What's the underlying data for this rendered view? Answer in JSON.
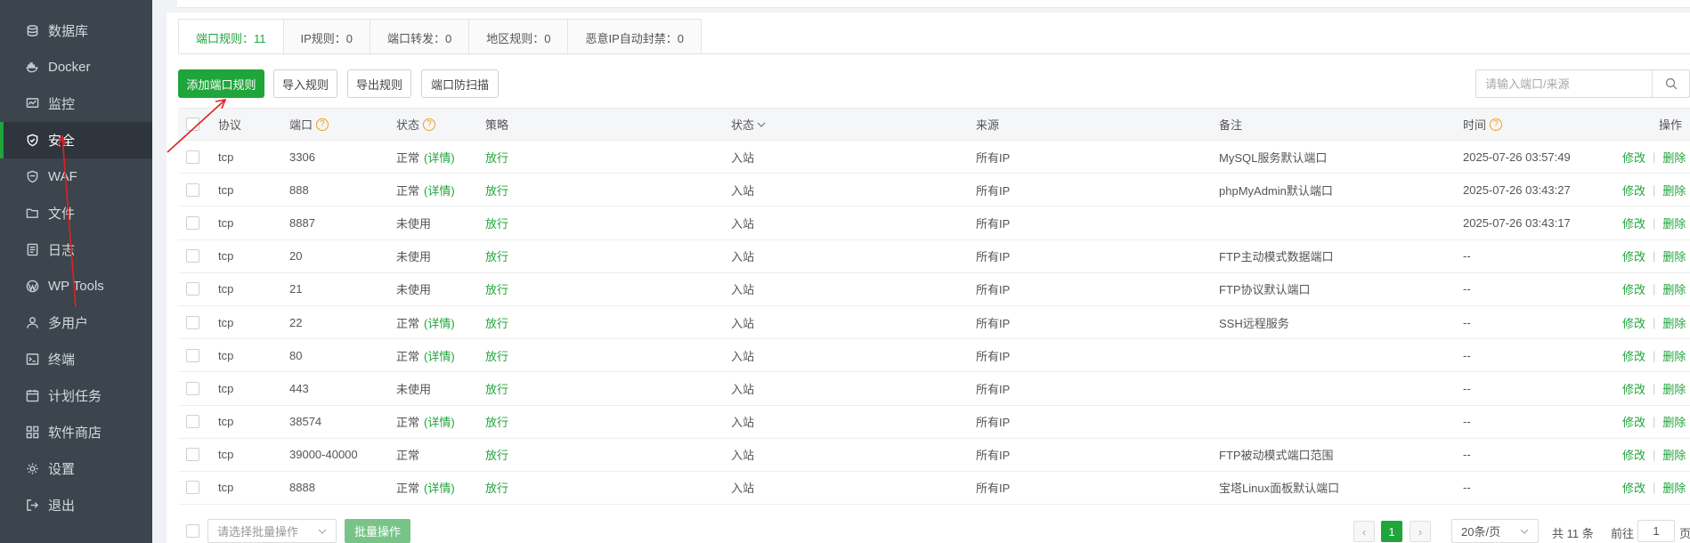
{
  "sidebar": {
    "items": [
      {
        "label": "数据库",
        "icon": "database-icon",
        "active": false
      },
      {
        "label": "Docker",
        "icon": "docker-icon",
        "active": false
      },
      {
        "label": "监控",
        "icon": "monitor-icon",
        "active": false
      },
      {
        "label": "安全",
        "icon": "shield-icon",
        "active": true
      },
      {
        "label": "WAF",
        "icon": "waf-icon",
        "active": false
      },
      {
        "label": "文件",
        "icon": "folder-icon",
        "active": false
      },
      {
        "label": "日志",
        "icon": "log-icon",
        "active": false
      },
      {
        "label": "WP Tools",
        "icon": "wordpress-icon",
        "active": false
      },
      {
        "label": "多用户",
        "icon": "users-icon",
        "active": false
      },
      {
        "label": "终端",
        "icon": "terminal-icon",
        "active": false
      },
      {
        "label": "计划任务",
        "icon": "calendar-icon",
        "active": false
      },
      {
        "label": "软件商店",
        "icon": "apps-icon",
        "active": false
      },
      {
        "label": "设置",
        "icon": "gear-icon",
        "active": false
      },
      {
        "label": "退出",
        "icon": "logout-icon",
        "active": false
      }
    ]
  },
  "tabs": [
    {
      "label": "端口规则：11",
      "active": true
    },
    {
      "label": "IP规则：0",
      "active": false
    },
    {
      "label": "端口转发：0",
      "active": false
    },
    {
      "label": "地区规则：0",
      "active": false
    },
    {
      "label": "恶意IP自动封禁：0",
      "active": false
    }
  ],
  "toolbar": {
    "add_label": "添加端口规则",
    "import_label": "导入规则",
    "export_label": "导出规则",
    "scan_label": "端口防扫描"
  },
  "search": {
    "placeholder": "请输入端口/来源"
  },
  "table": {
    "headers": {
      "protocol": "协议",
      "port": "端口",
      "status": "状态",
      "policy": "策略",
      "direction": "状态",
      "source": "来源",
      "remark": "备注",
      "time": "时间",
      "ops": "操作"
    },
    "rows": [
      {
        "protocol": "tcp",
        "port": "3306",
        "status": "正常",
        "detail": "(详情)",
        "policy": "放行",
        "direction": "入站",
        "source": "所有IP",
        "remark": "MySQL服务默认端口",
        "time": "2025-07-26 03:57:49",
        "edit": "修改",
        "delete": "删除"
      },
      {
        "protocol": "tcp",
        "port": "888",
        "status": "正常",
        "detail": "(详情)",
        "policy": "放行",
        "direction": "入站",
        "source": "所有IP",
        "remark": "phpMyAdmin默认端口",
        "time": "2025-07-26 03:43:27",
        "edit": "修改",
        "delete": "删除"
      },
      {
        "protocol": "tcp",
        "port": "8887",
        "status": "未使用",
        "detail": "",
        "policy": "放行",
        "direction": "入站",
        "source": "所有IP",
        "remark": "",
        "time": "2025-07-26 03:43:17",
        "edit": "修改",
        "delete": "删除"
      },
      {
        "protocol": "tcp",
        "port": "20",
        "status": "未使用",
        "detail": "",
        "policy": "放行",
        "direction": "入站",
        "source": "所有IP",
        "remark": "FTP主动模式数据端口",
        "time": "--",
        "edit": "修改",
        "delete": "删除"
      },
      {
        "protocol": "tcp",
        "port": "21",
        "status": "未使用",
        "detail": "",
        "policy": "放行",
        "direction": "入站",
        "source": "所有IP",
        "remark": "FTP协议默认端口",
        "time": "--",
        "edit": "修改",
        "delete": "删除"
      },
      {
        "protocol": "tcp",
        "port": "22",
        "status": "正常",
        "detail": "(详情)",
        "policy": "放行",
        "direction": "入站",
        "source": "所有IP",
        "remark": "SSH远程服务",
        "time": "--",
        "edit": "修改",
        "delete": "删除"
      },
      {
        "protocol": "tcp",
        "port": "80",
        "status": "正常",
        "detail": "(详情)",
        "policy": "放行",
        "direction": "入站",
        "source": "所有IP",
        "remark": "",
        "time": "--",
        "edit": "修改",
        "delete": "删除"
      },
      {
        "protocol": "tcp",
        "port": "443",
        "status": "未使用",
        "detail": "",
        "policy": "放行",
        "direction": "入站",
        "source": "所有IP",
        "remark": "",
        "time": "--",
        "edit": "修改",
        "delete": "删除"
      },
      {
        "protocol": "tcp",
        "port": "38574",
        "status": "正常",
        "detail": "(详情)",
        "policy": "放行",
        "direction": "入站",
        "source": "所有IP",
        "remark": "",
        "time": "--",
        "edit": "修改",
        "delete": "删除"
      },
      {
        "protocol": "tcp",
        "port": "39000-40000",
        "status": "正常",
        "detail": "",
        "policy": "放行",
        "direction": "入站",
        "source": "所有IP",
        "remark": "FTP被动模式端口范围",
        "time": "--",
        "edit": "修改",
        "delete": "删除"
      },
      {
        "protocol": "tcp",
        "port": "8888",
        "status": "正常",
        "detail": "(详情)",
        "policy": "放行",
        "direction": "入站",
        "source": "所有IP",
        "remark": "宝塔Linux面板默认端口",
        "time": "--",
        "edit": "修改",
        "delete": "删除"
      }
    ]
  },
  "footer": {
    "batch_select_placeholder": "请选择批量操作",
    "batch_button": "批量操作",
    "page_prev": "‹",
    "current_page": "1",
    "page_next": "›",
    "page_size": "20条/页",
    "total": "共 11 条",
    "goto_label": "前往",
    "goto_value": "1",
    "page_unit": "页"
  },
  "colors": {
    "accent": "#20a53a",
    "sidebar_bg": "#3c444d",
    "annotation_arrow": "#e02020"
  }
}
